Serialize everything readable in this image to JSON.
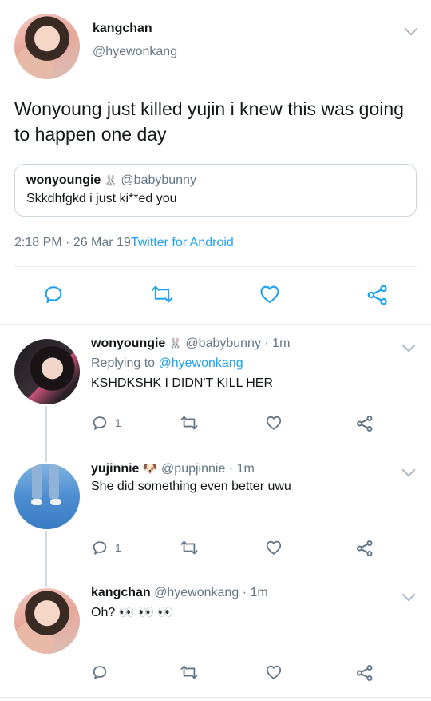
{
  "main_tweet": {
    "display_name": "kangchan",
    "handle": "@hyewonkang",
    "text": "Wonyoung just killed yujin i knew this was going to happen one day",
    "timestamp": "2:18 PM · 26 Mar 19",
    "source": "Twitter for Android",
    "quoted": {
      "display_name": "wonyoungie",
      "emoji": "🐰",
      "handle": "@babybunny",
      "text": "Skkdhfgkd i just ki**ed you"
    }
  },
  "replies": [
    {
      "display_name": "wonyoungie",
      "emoji": "🐰",
      "handle": "@babybunny",
      "time": "· 1m",
      "replying_prefix": "Replying to",
      "replying_to": "@hyewonkang",
      "text": "KSHDKSHK I DIDN'T KILL HER",
      "reply_count": "1"
    },
    {
      "display_name": "yujinnie",
      "emoji": "🐶",
      "handle": "@pupjinnie",
      "time": "· 1m",
      "text": "She did something even better uwu",
      "reply_count": "1"
    },
    {
      "display_name": "kangchan",
      "handle": "@hyewonkang",
      "time": "· 1m",
      "text": "Oh? 👀 👀 👀",
      "reply_count": ""
    }
  ],
  "icons": {
    "reply": "reply-icon",
    "retweet": "retweet-icon",
    "like": "heart-icon",
    "share": "share-icon",
    "more": "chevron-down-icon"
  },
  "colors": {
    "link": "#1da1f2",
    "muted": "#657786",
    "icon": "#657786",
    "main_icon": "#1da1f2"
  }
}
